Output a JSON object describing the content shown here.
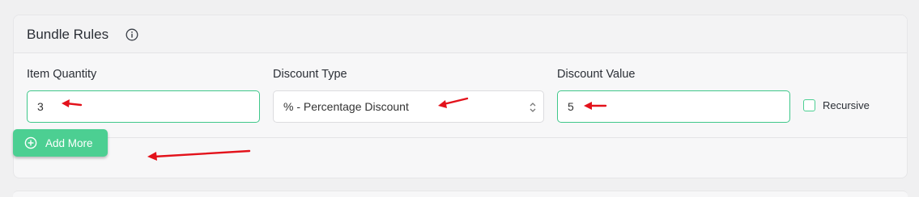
{
  "panel": {
    "title": "Bundle Rules",
    "info_icon": "info-circle-icon"
  },
  "fields": {
    "item_quantity": {
      "label": "Item Quantity",
      "value": "3"
    },
    "discount_type": {
      "label": "Discount Type",
      "value": "% - Percentage Discount",
      "arrows_icon": "select-updown-icon"
    },
    "discount_value": {
      "label": "Discount Value",
      "value": "5"
    },
    "recursive": {
      "label": "Recursive",
      "checked": false
    }
  },
  "add_more": {
    "label": "Add More",
    "icon": "plus-circle-icon"
  },
  "colors": {
    "accent": "#4ccf92",
    "input_border_active": "#3fc78a",
    "annotation_arrow": "#e3121b"
  }
}
